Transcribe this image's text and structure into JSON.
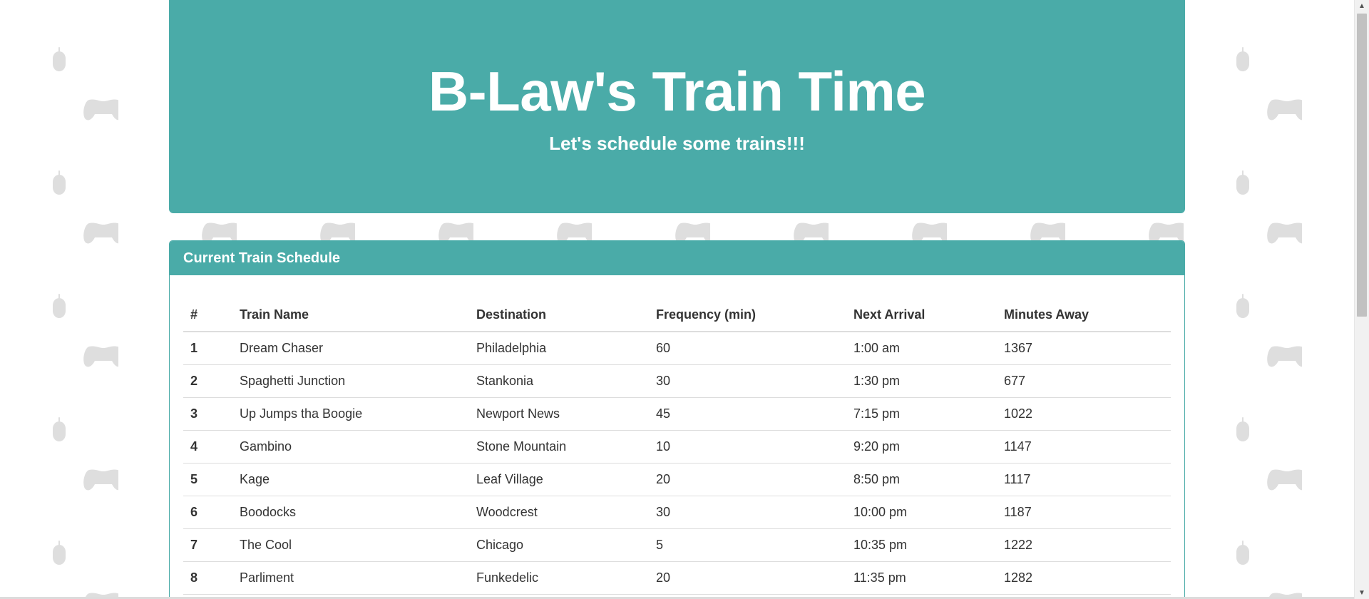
{
  "jumbotron": {
    "title": "B-Law's Train Time",
    "subtitle": "Let's schedule some trains!!!"
  },
  "panel": {
    "heading": "Current Train Schedule"
  },
  "table": {
    "headers": {
      "num": "#",
      "name": "Train Name",
      "destination": "Destination",
      "frequency": "Frequency (min)",
      "next_arrival": "Next Arrival",
      "minutes_away": "Minutes Away"
    },
    "rows": [
      {
        "num": "1",
        "name": "Dream Chaser",
        "destination": "Philadelphia",
        "frequency": "60",
        "next_arrival": "1:00 am",
        "minutes_away": "1367"
      },
      {
        "num": "2",
        "name": "Spaghetti Junction",
        "destination": "Stankonia",
        "frequency": "30",
        "next_arrival": "1:30 pm",
        "minutes_away": "677"
      },
      {
        "num": "3",
        "name": "Up Jumps tha Boogie",
        "destination": "Newport News",
        "frequency": "45",
        "next_arrival": "7:15 pm",
        "minutes_away": "1022"
      },
      {
        "num": "4",
        "name": "Gambino",
        "destination": "Stone Mountain",
        "frequency": "10",
        "next_arrival": "9:20 pm",
        "minutes_away": "1147"
      },
      {
        "num": "5",
        "name": "Kage",
        "destination": "Leaf Village",
        "frequency": "20",
        "next_arrival": "8:50 pm",
        "minutes_away": "1117"
      },
      {
        "num": "6",
        "name": "Boodocks",
        "destination": "Woodcrest",
        "frequency": "30",
        "next_arrival": "10:00 pm",
        "minutes_away": "1187"
      },
      {
        "num": "7",
        "name": "The Cool",
        "destination": "Chicago",
        "frequency": "5",
        "next_arrival": "10:35 pm",
        "minutes_away": "1222"
      },
      {
        "num": "8",
        "name": "Parliment",
        "destination": "Funkedelic",
        "frequency": "20",
        "next_arrival": "11:35 pm",
        "minutes_away": "1282"
      }
    ]
  },
  "icons": {
    "background_pattern": "game-controller-and-mouse-icon",
    "scroll_up": "arrow-up-icon",
    "scroll_down": "arrow-down-icon"
  },
  "colors": {
    "accent": "#4aaba8",
    "text": "#333333",
    "background_icon": "#dedede",
    "row_border": "#dddddd"
  }
}
